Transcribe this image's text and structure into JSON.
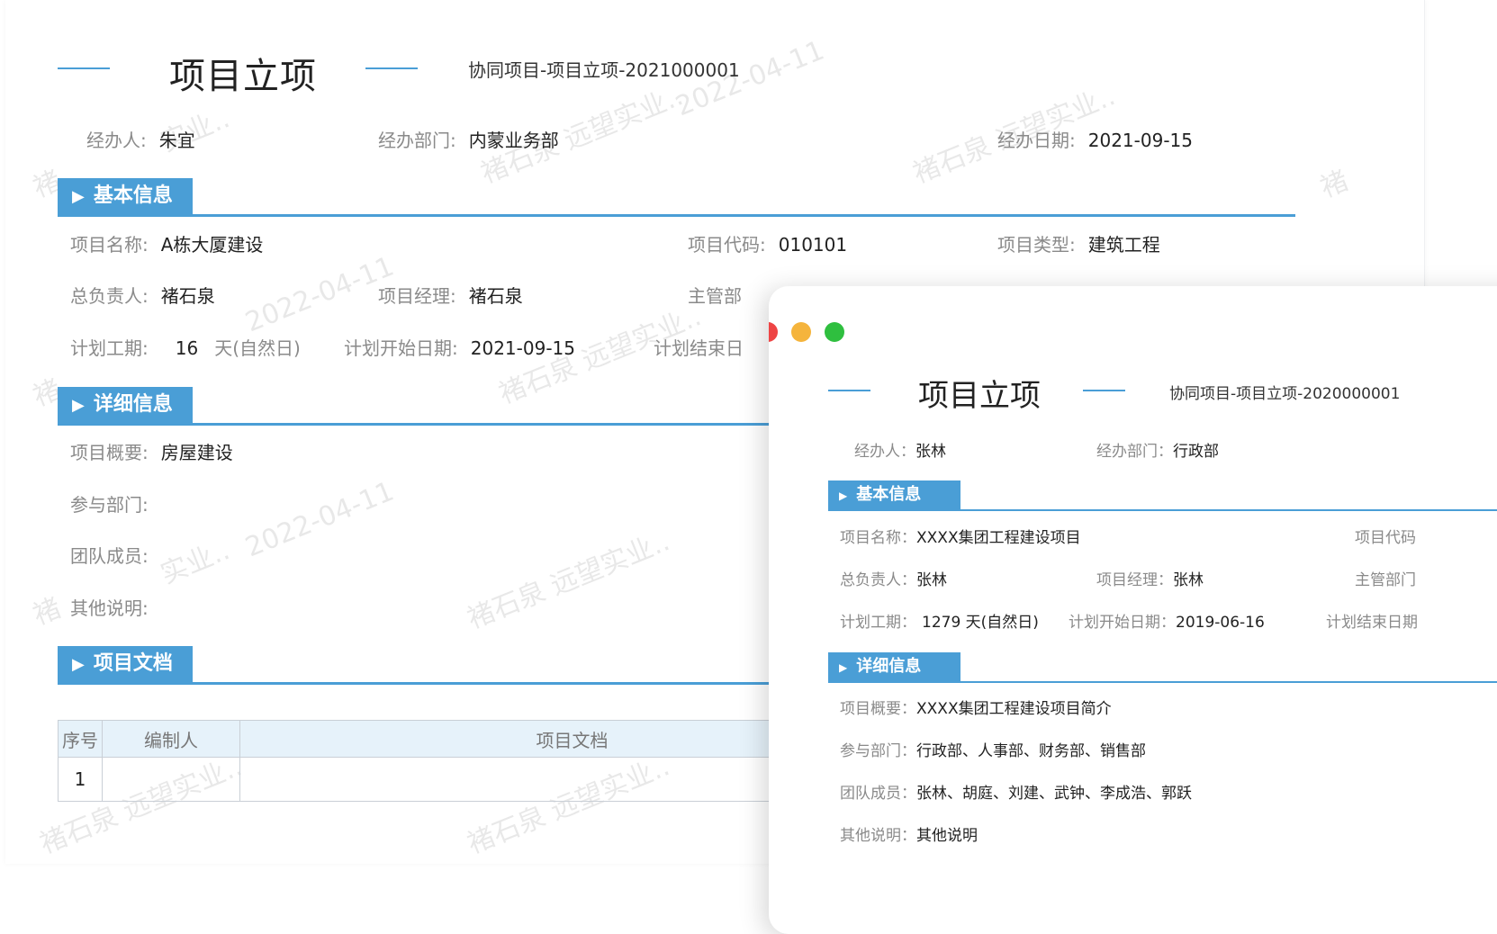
{
  "back": {
    "title": "项目立项",
    "doc_no": "协同项目-项目立项-2021000001",
    "handler_label": "经办人:",
    "handler": "朱宜",
    "dept_label": "经办部门:",
    "dept": "内蒙业务部",
    "date_label": "经办日期:",
    "date": "2021-09-15",
    "sections": {
      "basic": "基本信息",
      "detail": "详细信息",
      "docs": "项目文档"
    },
    "basic": {
      "name_label": "项目名称:",
      "name": "A栋大厦建设",
      "code_label": "项目代码:",
      "code": "010101",
      "type_label": "项目类型:",
      "type": "建筑工程",
      "owner_label": "总负责人:",
      "owner": "褚石泉",
      "manager_label": "项目经理:",
      "manager": "褚石泉",
      "dept_label": "主管部",
      "period_label": "计划工期:",
      "period": "16",
      "period_unit": "天(自然日)",
      "start_label": "计划开始日期:",
      "start": "2021-09-15",
      "end_label": "计划结束日"
    },
    "detail": {
      "summary_label": "项目概要:",
      "summary": "房屋建设",
      "depts_label": "参与部门:",
      "team_label": "团队成员:",
      "notes_label": "其他说明:"
    },
    "table": {
      "headers": [
        "序号",
        "编制人",
        "项目文档"
      ],
      "rows": [
        [
          "1",
          "",
          ""
        ]
      ]
    },
    "watermarks": [
      "2022-04-11",
      "褚石泉 远望实业..",
      "实业..",
      "褚"
    ]
  },
  "window": {
    "dots": [
      "#ee4444",
      "#f5b43c",
      "#2fbf3f"
    ],
    "title": "项目立项",
    "doc_no": "协同项目-项目立项-2020000001",
    "handler_label": "经办人：",
    "handler": "张林",
    "dept_label": "经办部门：",
    "dept": "行政部",
    "sections": {
      "basic": "基本信息",
      "detail": "详细信息"
    },
    "basic": {
      "name_label": "项目名称：",
      "name": "XXXX集团工程建设项目",
      "code_label": "项目代码",
      "owner_label": "总负责人：",
      "owner": "张林",
      "manager_label": "项目经理：",
      "manager": "张林",
      "dept_label": "主管部门",
      "period_label": "计划工期：",
      "period": "1279 天(自然日)",
      "start_label": "计划开始日期：",
      "start": "2019-06-16",
      "end_label": "计划结束日期"
    },
    "detail": {
      "summary_label": "项目概要：",
      "summary": "XXXX集团工程建设项目简介",
      "depts_label": "参与部门：",
      "depts": "行政部、人事部、财务部、销售部",
      "team_label": "团队成员：",
      "team": "张林、胡庭、刘建、武钟、李成浩、郭跃",
      "notes_label": "其他说明：",
      "notes": "其他说明"
    }
  },
  "colors": {
    "accent": "#4a9ed6",
    "table_header_bg": "#e6f2fa"
  }
}
